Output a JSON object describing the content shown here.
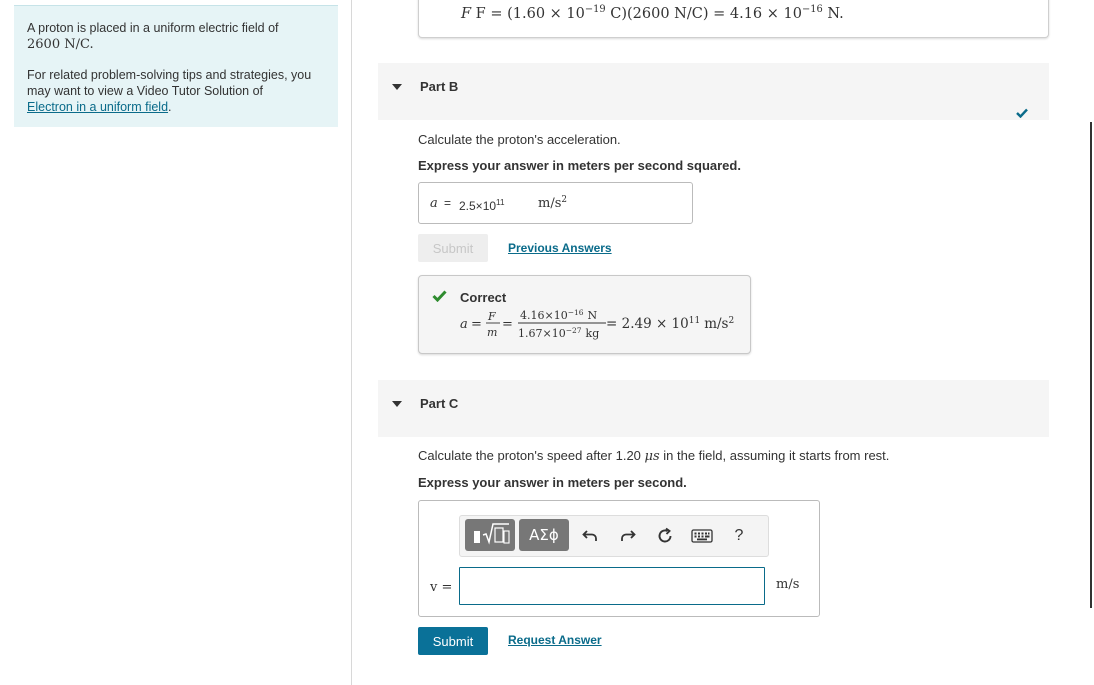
{
  "intro": {
    "line1_pre": "A proton is placed in a uniform electric field of",
    "line1_field": "2600 N/C.",
    "line2_pre": "For related problem-solving tips and strategies, you may want to view a Video Tutor Solution of",
    "link": "Electron in a uniform field",
    "line2_post": "."
  },
  "partA": {
    "eq_lhs": "F = (1.60 × 10",
    "eq_exp1": "−19",
    "eq_mid": " C)(2600 N/C) = 4.16 × 10",
    "eq_exp2": "−16",
    "eq_end": " N."
  },
  "partB": {
    "header": "Part B",
    "question": "Calculate the proton's acceleration.",
    "instruction": "Express your answer in meters per second squared.",
    "answer": {
      "var": "a",
      "eq": "=",
      "mantissa": "2.5×10",
      "exp": "11",
      "unit": "m/s",
      "unit_exp": "2"
    },
    "submit": "Submit",
    "previous": "Previous Answers",
    "feedback": {
      "title": "Correct",
      "lhs": "a",
      "eq": "=",
      "frac1_num": "F",
      "frac1_den": "m",
      "frac2_num": "4.16×10",
      "frac2_num_exp": "−16",
      "frac2_num_unit": "N",
      "frac2_den": "1.67×10",
      "frac2_den_exp": "−27",
      "frac2_den_unit": "kg",
      "result": "= 2.49 × 10",
      "result_exp": "11",
      "result_unit": "m/s",
      "result_unit_exp": "2"
    },
    "accent": "#0a6b8a",
    "correct_color": "#2e8b2e"
  },
  "partC": {
    "header": "Part C",
    "question_pre": "Calculate the proton's speed after 1.20 ",
    "question_mu": "μs",
    "question_post": " in the field, assuming it starts from rest.",
    "instruction": "Express your answer in meters per second.",
    "toolbar": {
      "templates_icon": "sqrt-template-icon",
      "symbols_label": "ΑΣϕ",
      "undo_icon": "undo-icon",
      "redo_icon": "redo-icon",
      "reset_icon": "reset-icon",
      "keyboard_icon": "keyboard-icon",
      "help_label": "?"
    },
    "var_label": "v =",
    "input_value": "",
    "unit": "m/s",
    "submit": "Submit",
    "request": "Request Answer"
  }
}
